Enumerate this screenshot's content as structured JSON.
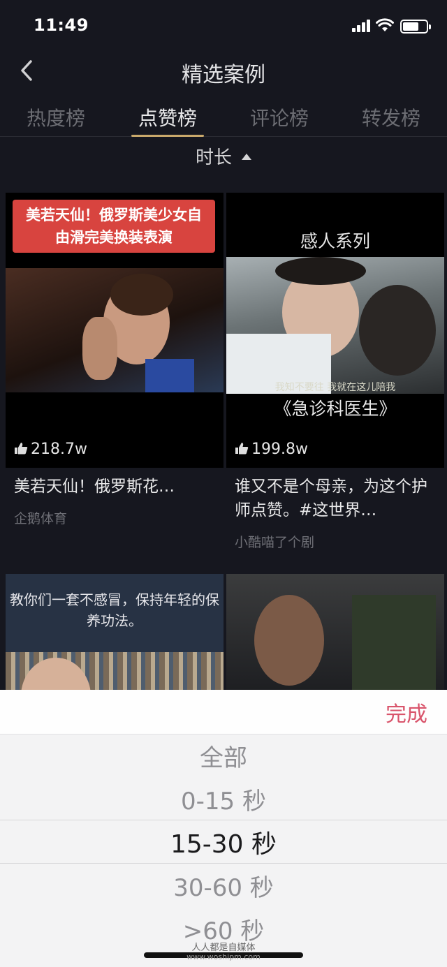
{
  "status_bar": {
    "time": "11:49"
  },
  "nav": {
    "title": "精选案例"
  },
  "tabs": [
    {
      "label": "热度榜",
      "active": false
    },
    {
      "label": "点赞榜",
      "active": true
    },
    {
      "label": "评论榜",
      "active": false
    },
    {
      "label": "转发榜",
      "active": false
    }
  ],
  "filter": {
    "label": "时长"
  },
  "cards": [
    {
      "banner": "美若天仙！俄罗斯美少女自由滑完美换装表演",
      "likes": "218.7w",
      "title": "美若天仙！俄罗斯花…",
      "author": "企鹅体育"
    },
    {
      "overlay_title": "感人系列",
      "subtitle": "我知不要往 我就在这儿陪我",
      "overlay_caption": "《急诊科医生》",
      "likes": "199.8w",
      "title": "谁又不是个母亲，为这个护师点赞。#这世界…",
      "author": "小酷喵了个剧"
    },
    {
      "banner": "教你们一套不感冒，保持年轻的保养功法。"
    },
    {}
  ],
  "picker": {
    "done_label": "完成",
    "options": [
      "全部",
      "0-15 秒",
      "15-30 秒",
      "30-60 秒",
      ">60 秒"
    ],
    "selected": "15-30 秒"
  },
  "watermark": {
    "text": "人人都是自媒体",
    "url": "www.woshipm.com"
  },
  "colors": {
    "accent_gold": "#c9a96b",
    "done_pink": "#d9546b",
    "banner_red": "#d8443f"
  }
}
